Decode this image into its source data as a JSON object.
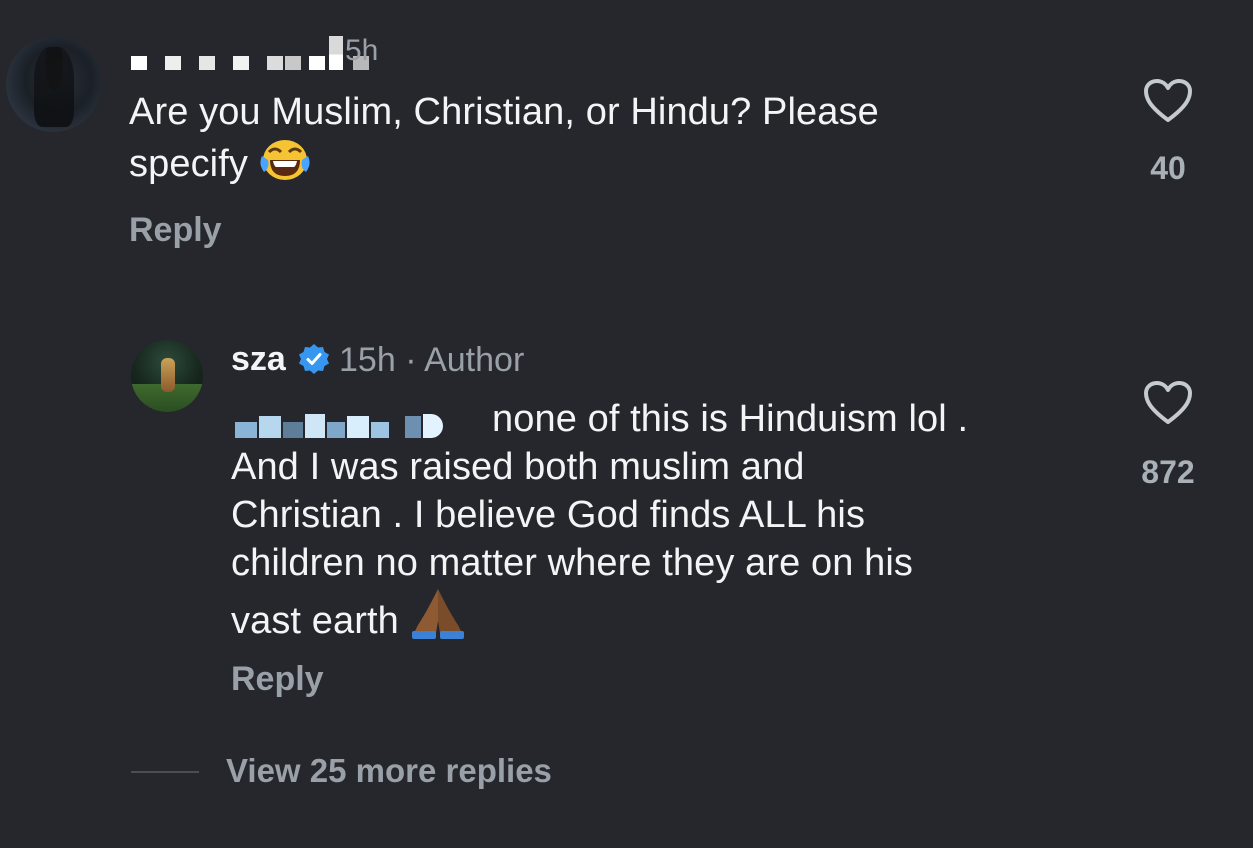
{
  "comment": {
    "time": "5h",
    "text_line1": "Are you Muslim, Christian, or Hindu? Please",
    "text_line2": "specify",
    "emoji": "laughing-face",
    "reply_label": "Reply",
    "like_count": "40"
  },
  "reply": {
    "username": "sza",
    "verified": true,
    "time": "15h",
    "separator": "·",
    "role": "Author",
    "text_line1": "none of this is Hinduism lol .",
    "text_line2": "And I was raised both muslim and",
    "text_line3": "Christian . I believe God finds ALL his",
    "text_line4": "children no matter where they are on his",
    "text_line5": "vast earth",
    "emoji": "folded-hands",
    "reply_label": "Reply",
    "like_count": "872"
  },
  "view_more_label": "View 25 more replies",
  "colors": {
    "background": "#25272c",
    "primary_text": "#f3f4f6",
    "secondary_text": "#9aa0a8",
    "verified_badge": "#3797f0"
  }
}
